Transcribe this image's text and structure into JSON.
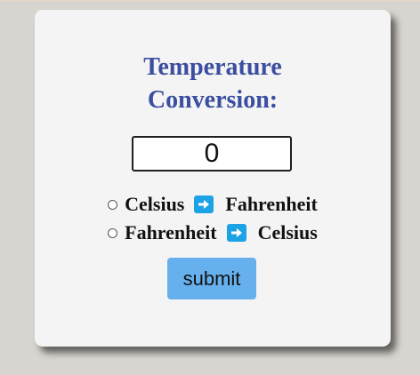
{
  "form": {
    "title_line1": "Temperature",
    "title_line2": "Conversion:",
    "input_value": "0",
    "options": [
      {
        "from": "Celsius",
        "to": "Fahrenheit",
        "icon": "right-arrow-icon"
      },
      {
        "from": "Fahrenheit",
        "to": "Celsius",
        "icon": "right-arrow-icon"
      }
    ],
    "submit_label": "submit"
  },
  "colors": {
    "background": "#d8d5d0",
    "card": "#f4f4f4",
    "title": "#3b4ea0",
    "arrow_badge": "#1ca3e6",
    "submit_button": "#67b0ee"
  }
}
